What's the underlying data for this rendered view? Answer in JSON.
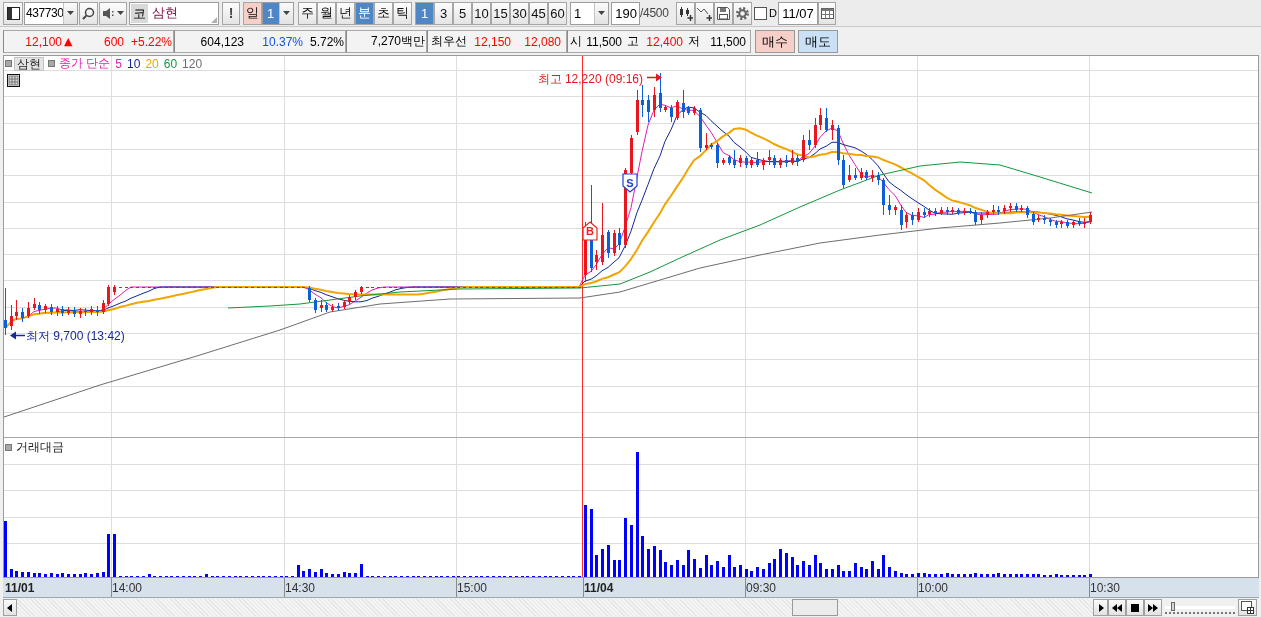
{
  "toolbar": {
    "stock_code": {
      "value": "437730"
    },
    "stock_name": {
      "market": "코",
      "value": "삼현"
    },
    "alert_button": {
      "label": "!"
    },
    "day_button": {
      "label": "일",
      "highlighted": true
    },
    "day_count": {
      "value": "1",
      "selected": true
    },
    "period_tabs": [
      {
        "label": "주",
        "selected": false
      },
      {
        "label": "월",
        "selected": false
      },
      {
        "label": "년",
        "selected": false
      },
      {
        "label": "분",
        "selected": true
      },
      {
        "label": "초",
        "selected": false
      },
      {
        "label": "틱",
        "selected": false
      }
    ],
    "interval_tabs": [
      {
        "label": "1",
        "selected": true
      },
      {
        "label": "3",
        "selected": false
      },
      {
        "label": "5",
        "selected": false
      },
      {
        "label": "10",
        "selected": false
      },
      {
        "label": "15",
        "selected": false
      },
      {
        "label": "30",
        "selected": false
      },
      {
        "label": "45",
        "selected": false
      },
      {
        "label": "60",
        "selected": false
      }
    ],
    "interval_select": {
      "value": "1"
    },
    "bar_count": {
      "value": "190",
      "total": "/4500"
    },
    "d_checkbox": {
      "label": "D",
      "checked": false
    },
    "date_field": {
      "value": "11/07"
    }
  },
  "quote": {
    "sections": [
      {
        "items": [
          {
            "text": "12,100",
            "kind": "value",
            "color": "#ff0000",
            "arrow": "▲"
          },
          {
            "text": "600",
            "kind": "value",
            "color": "#ff0000"
          },
          {
            "text": "+5.22%",
            "kind": "value",
            "color": "#ff0000"
          }
        ]
      },
      {
        "items": [
          {
            "text": "604,123",
            "kind": "value",
            "color": "#000000"
          },
          {
            "text": "10.37%",
            "kind": "value",
            "color": "#1050e0"
          },
          {
            "text": "5.72%",
            "kind": "value",
            "color": "#000000"
          }
        ]
      },
      {
        "items": [
          {
            "text": "7,270백만",
            "kind": "value",
            "color": "#000000"
          }
        ]
      },
      {
        "items": [
          {
            "text": "최우선",
            "kind": "label"
          },
          {
            "text": "12,150",
            "kind": "value",
            "color": "#ff0000"
          },
          {
            "text": "12,080",
            "kind": "value",
            "color": "#ff0000"
          }
        ]
      },
      {
        "items": [
          {
            "text": "시",
            "kind": "label"
          },
          {
            "text": "11,500",
            "kind": "value",
            "color": "#000000"
          },
          {
            "text": "고",
            "kind": "label"
          },
          {
            "text": "12,400",
            "kind": "value",
            "color": "#ff0000"
          },
          {
            "text": "저",
            "kind": "label"
          },
          {
            "text": "11,500",
            "kind": "value",
            "color": "#000000"
          }
        ]
      }
    ],
    "buttons": [
      {
        "label": "매수",
        "kind": "buy"
      },
      {
        "label": "매도",
        "kind": "sell"
      }
    ]
  },
  "chart": {
    "legend": {
      "stock": "삼현",
      "indicator": "종가 단순",
      "averages": [
        {
          "label": "5",
          "color": "#e020b0"
        },
        {
          "label": "10",
          "color": "#14289a"
        },
        {
          "label": "20",
          "color": "#f0a500"
        },
        {
          "label": "60",
          "color": "#14963c"
        },
        {
          "label": "120",
          "color": "#6e6e6e"
        }
      ]
    },
    "high_label": "최고 12,220 (09:16)",
    "low_label": "최저 9,700 (13:42)",
    "signals": [
      {
        "label": "B",
        "kind": "buy"
      },
      {
        "label": "S",
        "kind": "sell"
      }
    ],
    "volume_label": "거래대금",
    "x_axis": [
      {
        "label": "11/01",
        "kind": "date"
      },
      {
        "label": "14:00",
        "kind": "time"
      },
      {
        "label": "14:30",
        "kind": "time"
      },
      {
        "label": "15:00",
        "kind": "time"
      },
      {
        "label": "11/04",
        "kind": "date"
      },
      {
        "label": "09:30",
        "kind": "time"
      },
      {
        "label": "10:00",
        "kind": "time"
      },
      {
        "label": "10:30",
        "kind": "time"
      }
    ]
  },
  "scroll_bar": {
    "zoom_slider": {
      "level": 0.08
    }
  }
}
